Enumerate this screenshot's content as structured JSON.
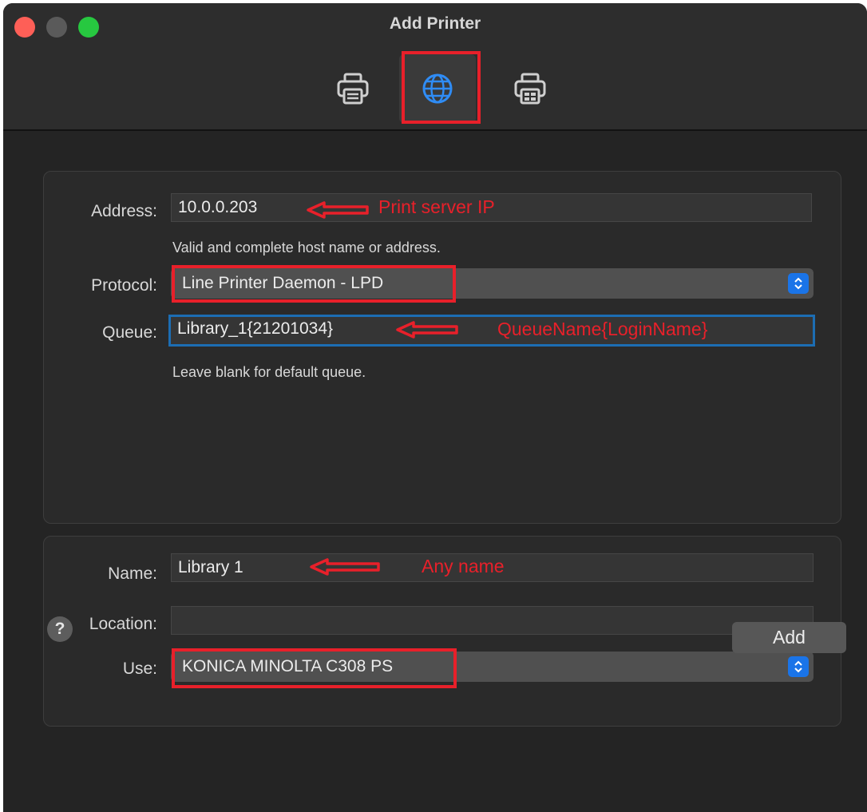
{
  "window": {
    "title": "Add Printer",
    "toolbar": [
      {
        "name": "Default",
        "icon": "printer-icon",
        "selected": false
      },
      {
        "name": "IP",
        "icon": "globe-icon",
        "selected": true
      },
      {
        "name": "Windows",
        "icon": "windows-printer-icon",
        "selected": false
      }
    ]
  },
  "connection": {
    "address_label": "Address:",
    "address_value": "10.0.0.203",
    "address_hint": "Valid and complete host name or address.",
    "protocol_label": "Protocol:",
    "protocol_value": "Line Printer Daemon - LPD",
    "queue_label": "Queue:",
    "queue_value": "Library_1{21201034}",
    "queue_hint": "Leave blank for default queue."
  },
  "details": {
    "name_label": "Name:",
    "name_value": "Library 1",
    "location_label": "Location:",
    "location_value": "",
    "use_label": "Use:",
    "use_value": "KONICA MINOLTA C308 PS"
  },
  "annotations": {
    "address_note": "Print server IP",
    "queue_note": "QueueName{LoginName}",
    "name_note": "Any name",
    "color": "#e8202a"
  },
  "footer": {
    "help_label": "?",
    "add_label": "Add"
  },
  "colors": {
    "accent": "#1a74e8",
    "background": "#242424"
  }
}
